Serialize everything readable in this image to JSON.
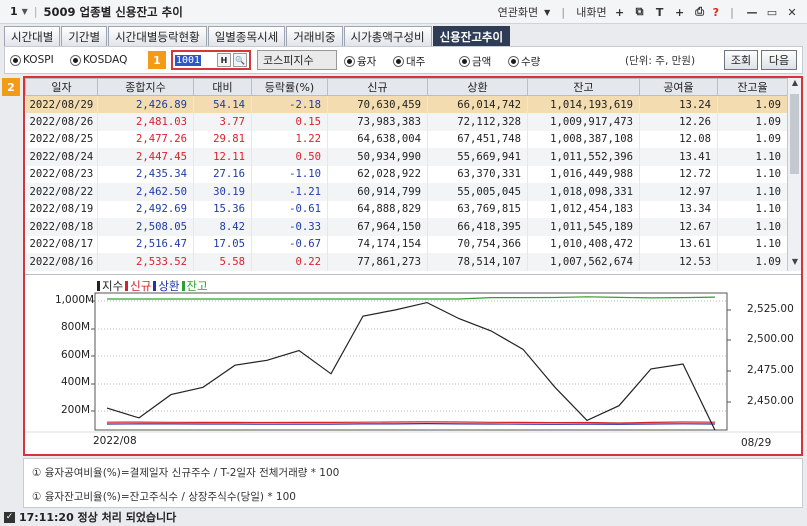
{
  "titlebar": {
    "number": "1",
    "title": "5009 업종별 신용잔고 추이",
    "related": "연관화면",
    "my_screen": "내화면",
    "help": "?"
  },
  "tabs": [
    {
      "label": "시간대별"
    },
    {
      "label": "기간별"
    },
    {
      "label": "시간대별등락현황"
    },
    {
      "label": "일별종목시세"
    },
    {
      "label": "거래비중"
    },
    {
      "label": "시가총액구성비"
    },
    {
      "label": "신용잔고추이"
    }
  ],
  "toolbar": {
    "market_kospi": "KOSPI",
    "market_kosdaq": "KOSDAQ",
    "badge1": "1",
    "code_value": "1001",
    "h_btn": "H",
    "name": "코스피지수",
    "opt_yungja": "융자",
    "opt_daeju": "대주",
    "opt_amount": "금액",
    "opt_qty": "수량",
    "unit": "(단위: 주, 만원)",
    "query_btn": "조회",
    "next_btn": "다음"
  },
  "badge2": "2",
  "table": {
    "headers": [
      "일자",
      "종합지수",
      "대비",
      "등락률(%)",
      "신규",
      "상환",
      "잔고",
      "공여율",
      "잔고율"
    ],
    "rows": [
      {
        "date": "2022/08/29",
        "index": "2,426.89",
        "diff": "54.14",
        "rate": "-2.18",
        "new": "70,630,459",
        "repay": "66,014,742",
        "bal": "1,014,193,619",
        "supply": "13.24",
        "balrate": "1.09",
        "dir": "dn"
      },
      {
        "date": "2022/08/26",
        "index": "2,481.03",
        "diff": "3.77",
        "rate": "0.15",
        "new": "73,983,383",
        "repay": "72,112,328",
        "bal": "1,009,917,473",
        "supply": "12.26",
        "balrate": "1.09",
        "dir": "up"
      },
      {
        "date": "2022/08/25",
        "index": "2,477.26",
        "diff": "29.81",
        "rate": "1.22",
        "new": "64,638,004",
        "repay": "67,451,748",
        "bal": "1,008,387,108",
        "supply": "12.08",
        "balrate": "1.09",
        "dir": "up"
      },
      {
        "date": "2022/08/24",
        "index": "2,447.45",
        "diff": "12.11",
        "rate": "0.50",
        "new": "50,934,990",
        "repay": "55,669,941",
        "bal": "1,011,552,396",
        "supply": "13.41",
        "balrate": "1.10",
        "dir": "up"
      },
      {
        "date": "2022/08/23",
        "index": "2,435.34",
        "diff": "27.16",
        "rate": "-1.10",
        "new": "62,028,922",
        "repay": "63,370,331",
        "bal": "1,016,449,988",
        "supply": "12.72",
        "balrate": "1.10",
        "dir": "dn"
      },
      {
        "date": "2022/08/22",
        "index": "2,462.50",
        "diff": "30.19",
        "rate": "-1.21",
        "new": "60,914,799",
        "repay": "55,005,045",
        "bal": "1,018,098,331",
        "supply": "12.97",
        "balrate": "1.10",
        "dir": "dn"
      },
      {
        "date": "2022/08/19",
        "index": "2,492.69",
        "diff": "15.36",
        "rate": "-0.61",
        "new": "64,888,829",
        "repay": "63,769,815",
        "bal": "1,012,454,183",
        "supply": "13.34",
        "balrate": "1.10",
        "dir": "dn"
      },
      {
        "date": "2022/08/18",
        "index": "2,508.05",
        "diff": "8.42",
        "rate": "-0.33",
        "new": "67,964,150",
        "repay": "66,418,395",
        "bal": "1,011,545,189",
        "supply": "12.67",
        "balrate": "1.10",
        "dir": "dn"
      },
      {
        "date": "2022/08/17",
        "index": "2,516.47",
        "diff": "17.05",
        "rate": "-0.67",
        "new": "74,174,154",
        "repay": "70,754,366",
        "bal": "1,010,408,472",
        "supply": "13.61",
        "balrate": "1.10",
        "dir": "dn"
      },
      {
        "date": "2022/08/16",
        "index": "2,533.52",
        "diff": "5.58",
        "rate": "0.22",
        "new": "77,861,273",
        "repay": "78,514,107",
        "bal": "1,007,562,674",
        "supply": "12.53",
        "balrate": "1.09",
        "dir": "up"
      }
    ]
  },
  "chart": {
    "legend": [
      {
        "label": "지수",
        "color": "#222222"
      },
      {
        "label": "신규",
        "color": "#d8222a"
      },
      {
        "label": "상환",
        "color": "#2233aa"
      },
      {
        "label": "잔고",
        "color": "#2fa02f"
      }
    ],
    "left_ticks": [
      "1,000M",
      "800M",
      "600M",
      "400M",
      "200M"
    ],
    "right_ticks": [
      "2,525.00",
      "2,500.00",
      "2,475.00",
      "2,450.00"
    ],
    "x_start": "2022/08",
    "x_end": "08/29"
  },
  "chart_data": {
    "type": "line",
    "x_start": "2022/08",
    "x_end": "08/29",
    "left_axis_ticks": [
      "1,000M",
      "800M",
      "600M",
      "400M",
      "200M"
    ],
    "right_axis_ticks": [
      "2,525.00",
      "2,500.00",
      "2,475.00",
      "2,450.00"
    ],
    "index_series": [
      2445,
      2437,
      2456,
      2462,
      2480,
      2484,
      2492,
      2473,
      2520,
      2525,
      2531,
      2518,
      2508,
      2493,
      2462,
      2435,
      2447,
      2477,
      2481,
      2427
    ],
    "balance_series_M": [
      1000,
      1000,
      1000,
      1000,
      1000,
      1000,
      1000,
      1000,
      1000,
      1000,
      1000,
      1000,
      1010,
      1010,
      1011,
      1016,
      1012,
      1008,
      1010,
      1014
    ],
    "new_series_M": [
      70,
      72,
      68,
      66,
      65,
      62,
      64,
      66,
      70,
      74,
      78,
      74,
      68,
      65,
      61,
      62,
      51,
      65,
      74,
      71
    ],
    "repay_series_M": [
      68,
      70,
      69,
      67,
      66,
      60,
      63,
      65,
      69,
      71,
      79,
      71,
      66,
      64,
      55,
      63,
      56,
      67,
      72,
      66
    ]
  },
  "notes": [
    "① 융자공여비율(%)=결제일자 신규주수 / T-2일자 전체거래량 * 100",
    "① 융자잔고비율(%)=잔고주식수 / 상장주식수(당일) * 100"
  ],
  "status": "17:11:20  정상 처리 되었습니다"
}
